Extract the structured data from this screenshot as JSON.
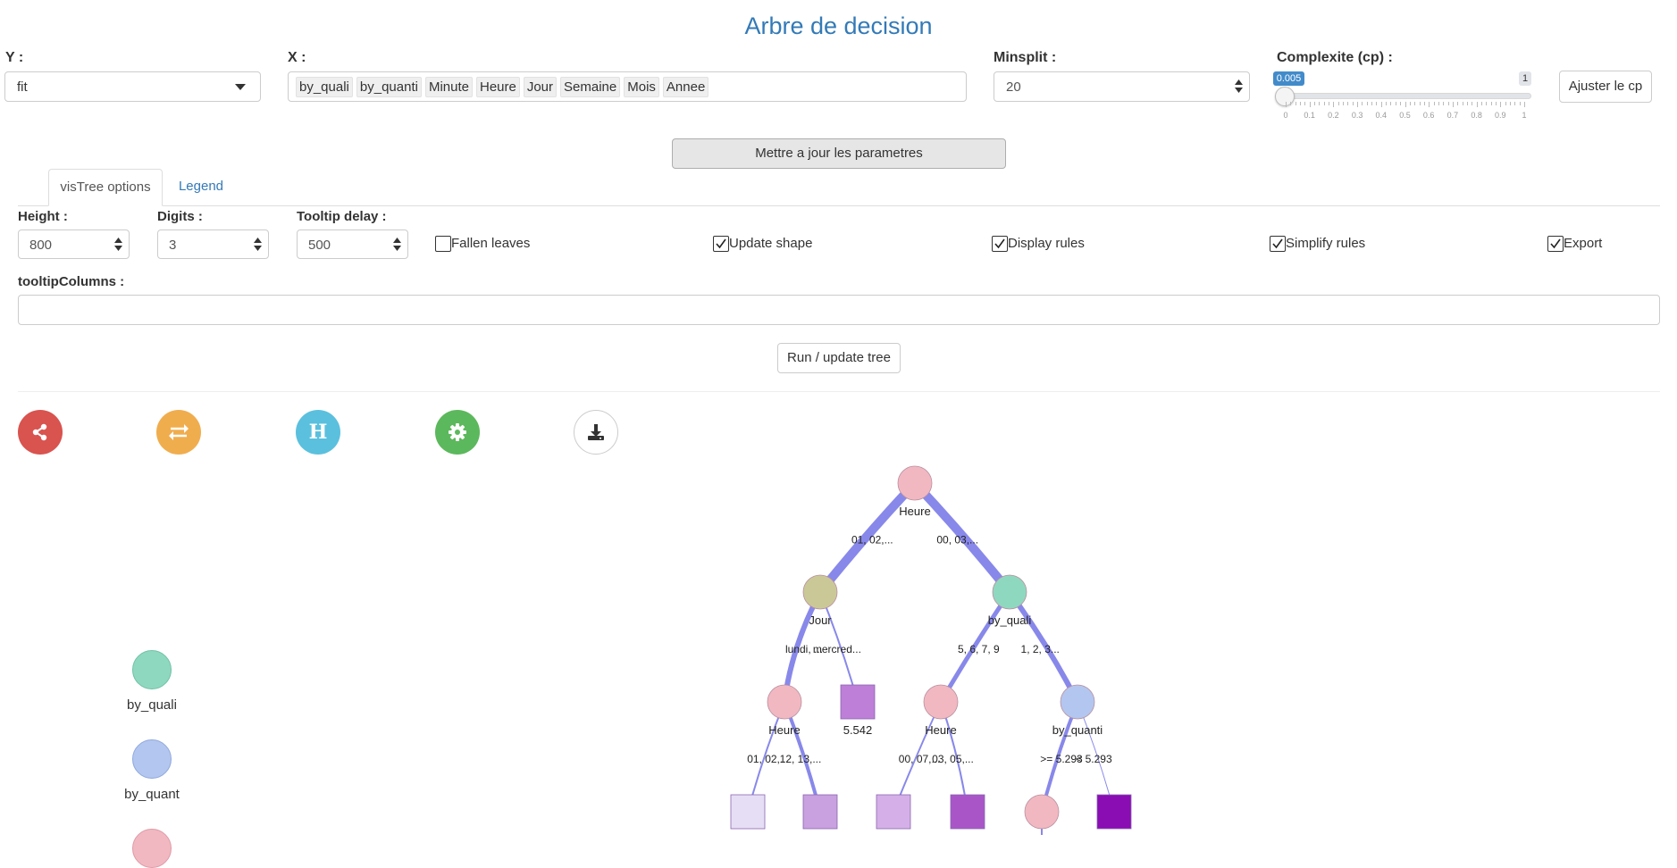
{
  "page": {
    "title": "Arbre de decision"
  },
  "controls": {
    "y": {
      "label": "Y :",
      "value": "fit"
    },
    "x": {
      "label": "X :",
      "tags": [
        "by_quali",
        "by_quanti",
        "Minute",
        "Heure",
        "Jour",
        "Semaine",
        "Mois",
        "Annee"
      ]
    },
    "minsplit": {
      "label": "Minsplit :",
      "value": "20"
    },
    "cp": {
      "label": "Complexite (cp) :",
      "value_badge": "0.005",
      "max_badge": "1",
      "value": 0.005,
      "range": [
        0,
        1
      ],
      "ticks": [
        "0",
        "0.1",
        "0.2",
        "0.3",
        "0.4",
        "0.5",
        "0.6",
        "0.7",
        "0.8",
        "0.9",
        "1"
      ]
    },
    "adjust_button": "Ajuster le cp",
    "update_button": "Mettre a jour les parametres"
  },
  "tabs": [
    {
      "label": "visTree options",
      "active": true
    },
    {
      "label": "Legend",
      "active": false
    }
  ],
  "options": {
    "height": {
      "label": "Height :",
      "value": "800"
    },
    "digits": {
      "label": "Digits :",
      "value": "3"
    },
    "tooltip_delay": {
      "label": "Tooltip delay :",
      "value": "500"
    },
    "checkboxes": [
      {
        "label": "Fallen leaves",
        "checked": false
      },
      {
        "label": "Update shape",
        "checked": true
      },
      {
        "label": "Display rules",
        "checked": true
      },
      {
        "label": "Simplify rules",
        "checked": true
      },
      {
        "label": "Export",
        "checked": true
      }
    ],
    "tooltip_columns": {
      "label": "tooltipColumns :",
      "value": ""
    },
    "run_button": "Run / update tree"
  },
  "toolbar_icons": [
    {
      "name": "share-icon",
      "color": "#d9534f"
    },
    {
      "name": "swap-icon",
      "color": "#f0ad4e"
    },
    {
      "name": "h-icon",
      "color": "#5bc0de"
    },
    {
      "name": "gear-icon",
      "color": "#5cb85c"
    },
    {
      "name": "download-icon",
      "color": "#ffffff"
    }
  ],
  "legend": [
    {
      "label": "by_quali",
      "color": "#8fd8c0"
    },
    {
      "label": "by_quant",
      "color": "#b3c6ef"
    }
  ],
  "tree": {
    "nodes": [
      {
        "id": "n1",
        "label": "Heure",
        "color": "#f2b8c2",
        "shape": "circle"
      },
      {
        "id": "n2",
        "label": "Jour",
        "color": "#cbc897",
        "shape": "circle"
      },
      {
        "id": "n3",
        "label": "by_quali",
        "color": "#8fd8c0",
        "shape": "circle"
      },
      {
        "id": "n4",
        "label": "Heure",
        "color": "#f2b8c2",
        "shape": "circle"
      },
      {
        "id": "n5",
        "label": "5.542",
        "color": "#be7fd8",
        "shape": "square"
      },
      {
        "id": "n6",
        "label": "Heure",
        "color": "#f2b8c2",
        "shape": "circle"
      },
      {
        "id": "n7",
        "label": "by_quanti",
        "color": "#b3c6ef",
        "shape": "circle"
      },
      {
        "id": "n8",
        "label": "",
        "color": "#e6def5",
        "shape": "square"
      },
      {
        "id": "n9",
        "label": "",
        "color": "#c9a0e0",
        "shape": "square"
      },
      {
        "id": "n10",
        "label": "",
        "color": "#d5b0e8",
        "shape": "square"
      },
      {
        "id": "n11",
        "label": "",
        "color": "#a955c8",
        "shape": "square"
      },
      {
        "id": "n12",
        "label": "",
        "color": "#f2b8c2",
        "shape": "circle"
      },
      {
        "id": "n13",
        "label": "",
        "color": "#8a0cb3",
        "shape": "square"
      },
      {
        "id": "n14",
        "label": "",
        "color": "#f2b8c2",
        "shape": "circle"
      }
    ],
    "edges": [
      {
        "from": "n1",
        "to": "n2",
        "label": "01, 02,..."
      },
      {
        "from": "n1",
        "to": "n3",
        "label": "00, 03,..."
      },
      {
        "from": "n2",
        "to": "n4",
        "label": "lundi, ..."
      },
      {
        "from": "n2",
        "to": "n5",
        "label": "mercred..."
      },
      {
        "from": "n3",
        "to": "n6",
        "label": "5, 6, 7, 9"
      },
      {
        "from": "n3",
        "to": "n7",
        "label": "1, 2, 3..."
      },
      {
        "from": "n4",
        "to": "n8",
        "label": "01, 02,..."
      },
      {
        "from": "n4",
        "to": "n9",
        "label": "12, 13,..."
      },
      {
        "from": "n6",
        "to": "n10",
        "label": "00, 07,..."
      },
      {
        "from": "n6",
        "to": "n11",
        "label": "03, 05,..."
      },
      {
        "from": "n7",
        "to": "n12",
        "label": ">= 5.293"
      },
      {
        "from": "n7",
        "to": "n13",
        "label": "< 5.293"
      },
      {
        "from": "n12",
        "to": "n14",
        "label": ""
      }
    ]
  }
}
